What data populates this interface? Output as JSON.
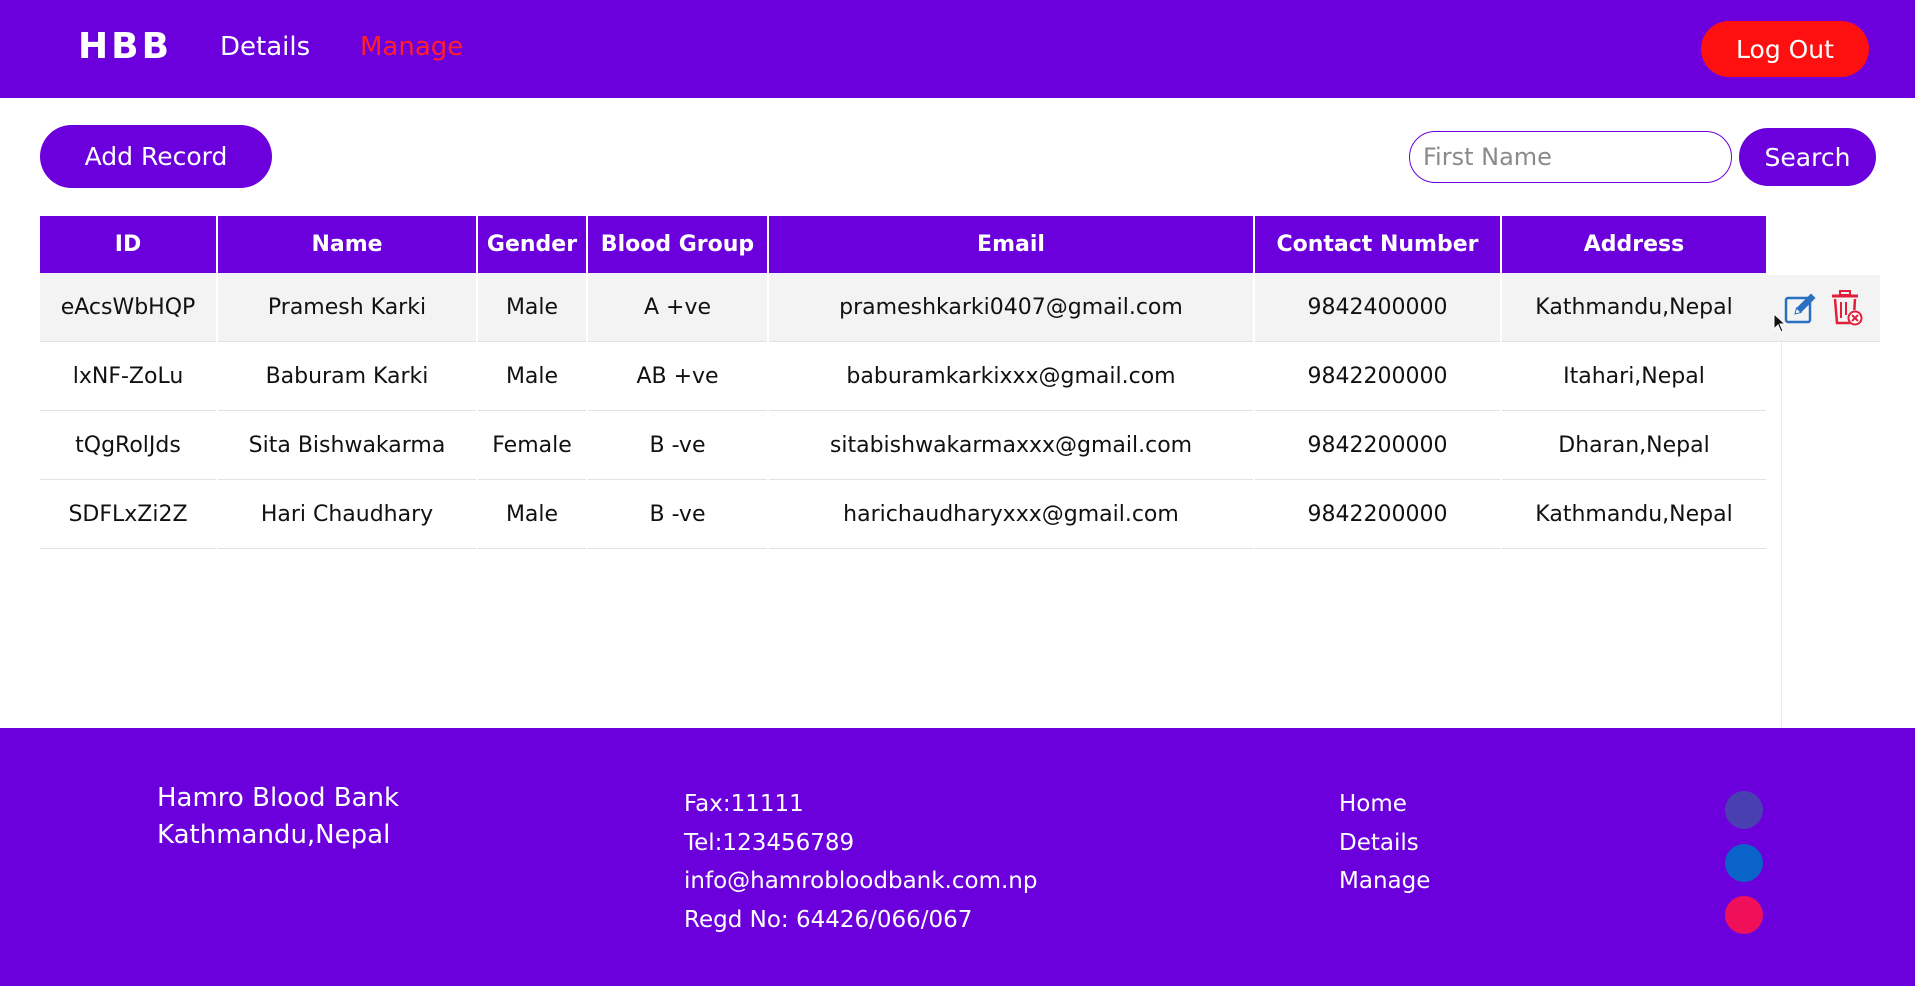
{
  "nav": {
    "brand": "HBB",
    "links": [
      {
        "label": "Details"
      },
      {
        "label": "Manage",
        "active": true
      }
    ],
    "logout_label": "Log Out"
  },
  "toolbar": {
    "add_label": "Add Record",
    "search_placeholder": "First Name",
    "search_value": "",
    "search_label": "Search"
  },
  "table": {
    "headers": [
      "ID",
      "Name",
      "Gender",
      "Blood Group",
      "Email",
      "Contact Number",
      "Address"
    ],
    "rows": [
      [
        "eAcsWbHQP",
        "Pramesh Karki",
        "Male",
        "A +ve",
        "prameshkarki0407@gmail.com",
        "9842400000",
        "Kathmandu,Nepal"
      ],
      [
        "lxNF-ZoLu",
        "Baburam Karki",
        "Male",
        "AB +ve",
        "baburamkarkixxx@gmail.com",
        "9842200000",
        "Itahari,Nepal"
      ],
      [
        "tQgRolJds",
        "Sita Bishwakarma",
        "Female",
        "B -ve",
        "sitabishwakarmaxxx@gmail.com",
        "9842200000",
        "Dharan,Nepal"
      ],
      [
        "SDFLxZi2Z",
        "Hari Chaudhary",
        "Male",
        "B -ve",
        "harichaudharyxxx@gmail.com",
        "9842200000",
        "Kathmandu,Nepal"
      ]
    ],
    "hover_row": 0,
    "row_actions": [
      "edit-icon",
      "delete-icon"
    ]
  },
  "footer": {
    "brand": [
      "Hamro Blood Bank",
      "Kathmandu,Nepal"
    ],
    "contact": [
      "Fax:11111",
      "Tel:123456789",
      "info@hamrobloodbank.com.np",
      "Regd No: 64426/066/067"
    ],
    "links": [
      "Home",
      "Details",
      "Manage"
    ],
    "social_colors": [
      "#4a3fb0",
      "#0a63c8",
      "#f0105a"
    ]
  },
  "colors": {
    "primary": "#6c00dc",
    "danger": "#ff1010",
    "active_link": "#ff1f2a"
  }
}
